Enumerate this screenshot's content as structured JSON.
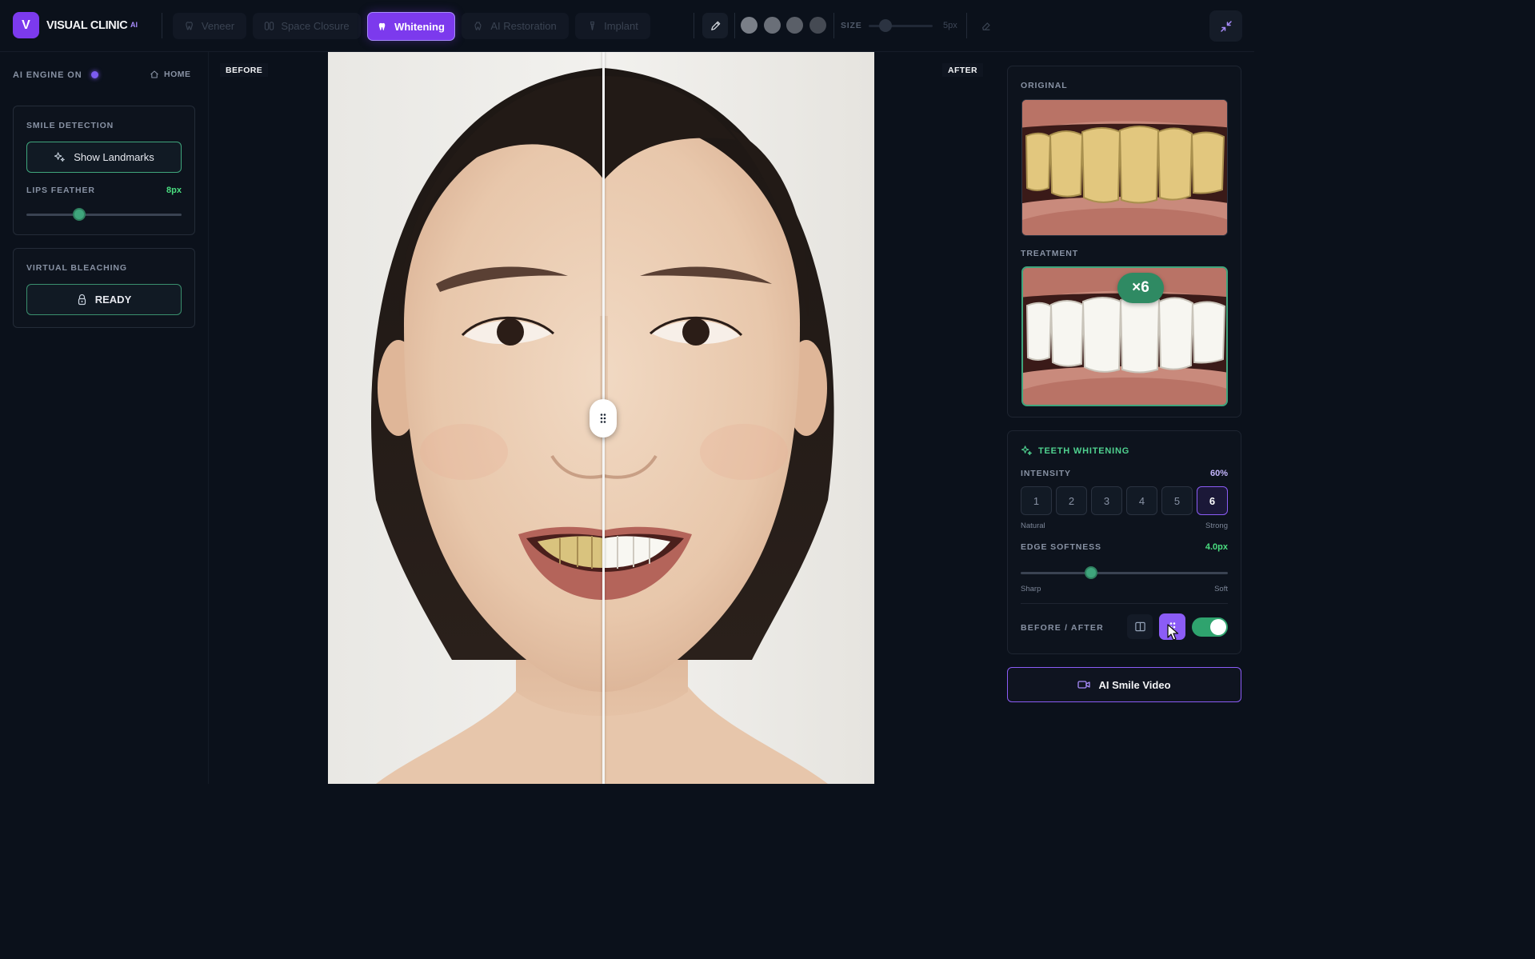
{
  "app": {
    "logo_letter": "V",
    "name": "VISUAL CLINIC",
    "badge": "AI"
  },
  "tabs": [
    {
      "label": "Veneer",
      "active": false
    },
    {
      "label": "Space Closure",
      "active": false
    },
    {
      "label": "Whitening",
      "active": true
    },
    {
      "label": "AI Restoration",
      "active": false
    },
    {
      "label": "Implant",
      "active": false
    }
  ],
  "toolbar": {
    "colors": [
      "#7a7f88",
      "#6a6f78",
      "#5a5f68",
      "#454a53"
    ],
    "size_label": "SIZE",
    "size_value": "5px"
  },
  "sidebar": {
    "engine_status": "AI ENGINE ON",
    "home_label": "HOME",
    "smile_detection": {
      "title": "SMILE DETECTION",
      "button_label": "Show Landmarks",
      "feather_label": "LIPS FEATHER",
      "feather_value": "8px",
      "feather_fraction": 0.34
    },
    "bleaching": {
      "title": "VIRTUAL BLEACHING",
      "button_label": "READY"
    }
  },
  "canvas": {
    "before_label": "BEFORE",
    "after_label": "AFTER",
    "split_fraction": 0.503
  },
  "preview": {
    "original_label": "ORIGINAL",
    "treatment_label": "TREATMENT",
    "treatment_badge": "×6"
  },
  "whitening": {
    "title": "TEETH WHITENING",
    "intensity_label": "INTENSITY",
    "intensity_value": "60%",
    "levels": [
      "1",
      "2",
      "3",
      "4",
      "5",
      "6"
    ],
    "active_level": "6",
    "natural_label": "Natural",
    "strong_label": "Strong",
    "edge_label": "EDGE SOFTNESS",
    "edge_value": "4.0px",
    "edge_fraction": 0.34,
    "sharp_label": "Sharp",
    "soft_label": "Soft",
    "before_after_label": "BEFORE / AFTER",
    "before_after_on": true
  },
  "video_button_label": "AI Smile Video",
  "colors": {
    "accent": "#7c3aed",
    "green": "#3fa57c",
    "background": "#0b111b"
  }
}
